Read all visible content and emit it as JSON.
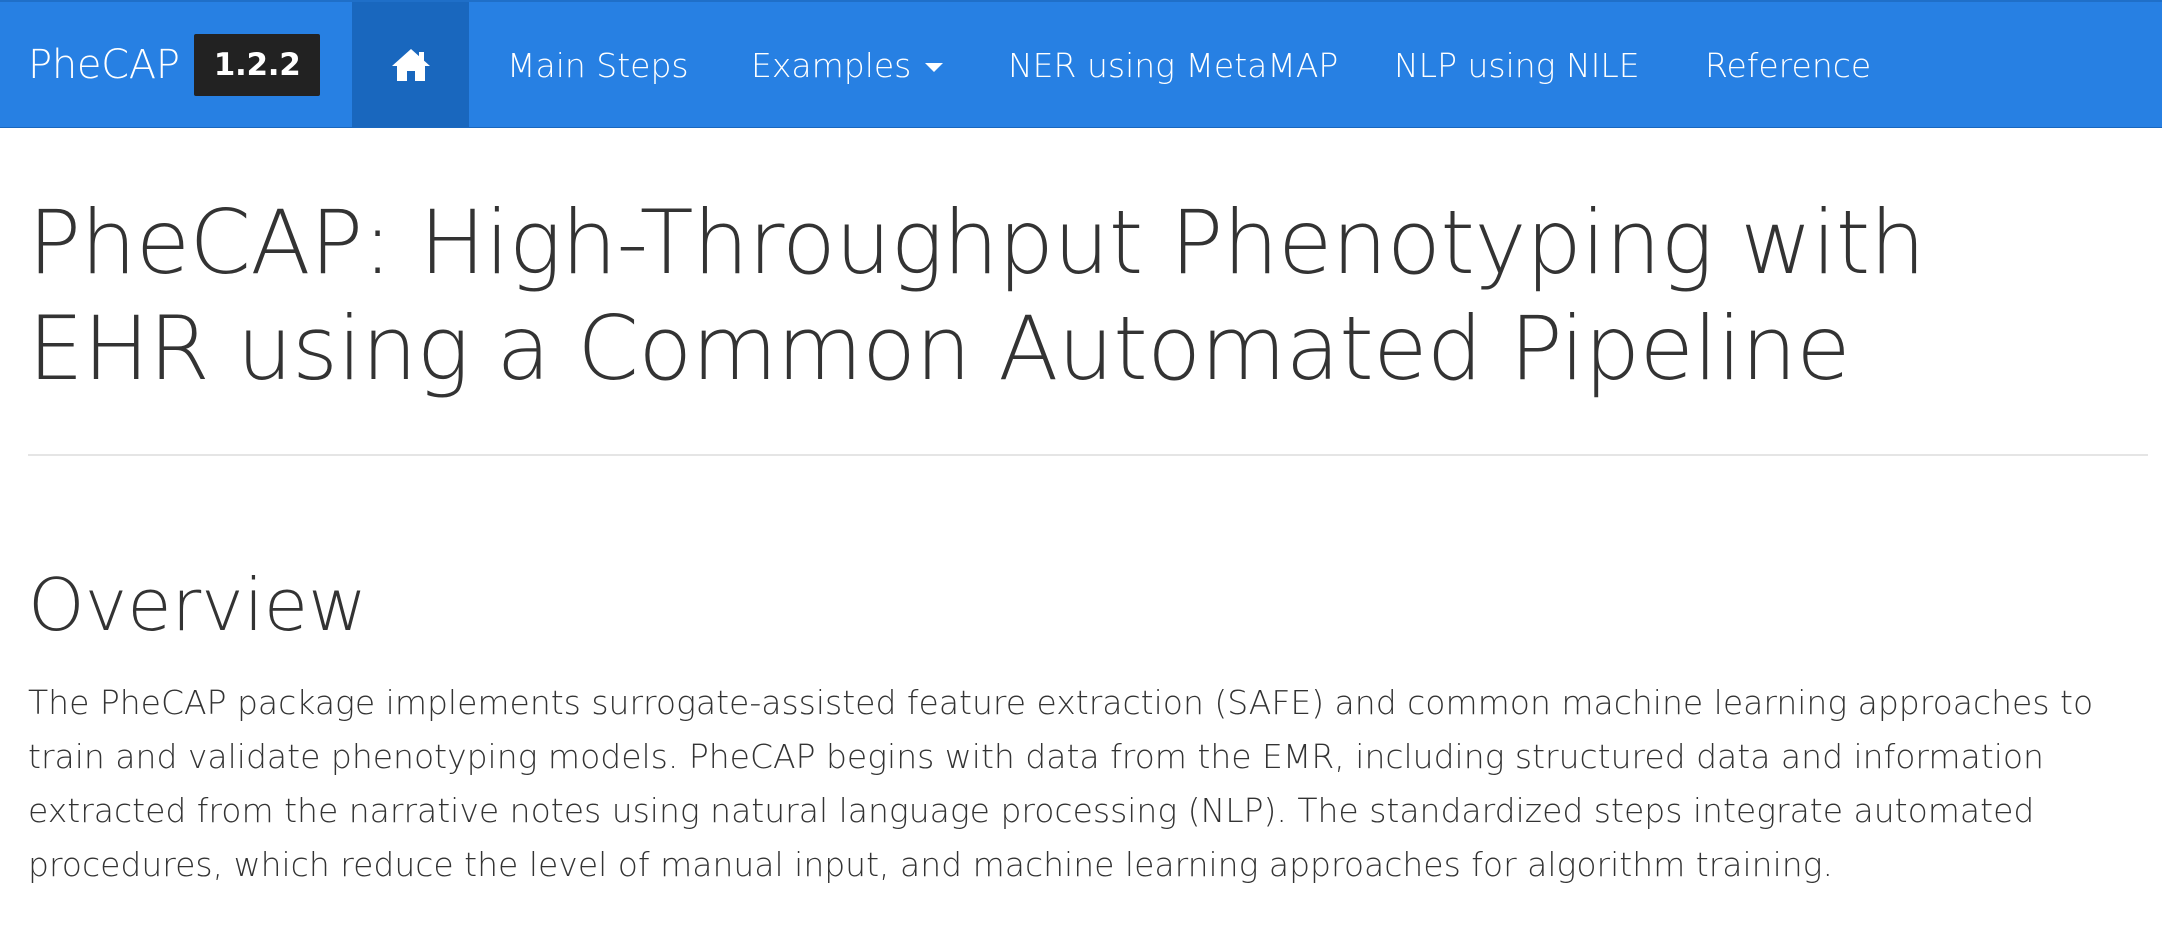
{
  "navbar": {
    "brand": "PheCAP",
    "version": "1.2.2",
    "home_icon": "home-icon",
    "items": [
      {
        "label": "Main Steps"
      },
      {
        "label": "Examples",
        "has_dropdown": true
      },
      {
        "label": "NER using MetaMAP"
      },
      {
        "label": "NLP using NILE"
      },
      {
        "label": "Reference"
      }
    ],
    "colors": {
      "background": "#2780e3",
      "active": "#1967be",
      "version_badge": "#222222"
    }
  },
  "main": {
    "title": "PheCAP: High-Throughput Phenotyping with EHR using a Common Automated Pipeline",
    "overview": {
      "heading": "Overview",
      "text": "The PheCAP package implements surrogate-assisted feature extraction (SAFE) and common machine learning approaches to train and validate phenotyping models. PheCAP begins with data from the EMR, including structured data and information extracted from the narrative notes using natural language processing (NLP). The standardized steps integrate automated procedures, which reduce the level of manual input, and machine learning approaches for algorithm training."
    }
  }
}
